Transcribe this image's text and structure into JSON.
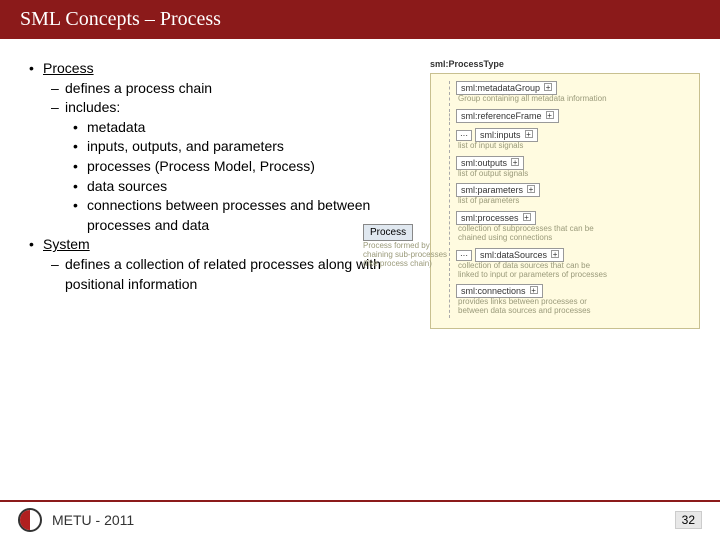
{
  "title": "SML Concepts – Process",
  "bullets": {
    "process": {
      "head": "Process",
      "sub1": "defines a process chain",
      "sub2": "includes:",
      "inc1": "metadata",
      "inc2": "inputs, outputs, and parameters",
      "inc3": "processes (Process Model, Process)",
      "inc4": "data sources",
      "inc5": "connections between processes and between processes and data"
    },
    "system": {
      "head": "System",
      "sub1": "defines a collection of related processes along with positional information"
    }
  },
  "diagram": {
    "root": "sml:ProcessType",
    "chip": "Process",
    "chip_note": "Process formed by chaining sub-processes (like process chain)",
    "items": [
      {
        "tag": "sml:metadataGroup",
        "desc": "Group containing all metadata information",
        "dots": false
      },
      {
        "tag": "sml:referenceFrame",
        "desc": "",
        "dots": false
      },
      {
        "tag": "sml:inputs",
        "desc": "list of input signals",
        "dots": true
      },
      {
        "tag": "sml:outputs",
        "desc": "list of output signals",
        "dots": false
      },
      {
        "tag": "sml:parameters",
        "desc": "list of parameters",
        "dots": false
      },
      {
        "tag": "sml:processes",
        "desc": "collection of subprocesses that can be chained using connections",
        "dots": false
      },
      {
        "tag": "sml:dataSources",
        "desc": "collection of data sources that can be linked to input or parameters of processes",
        "dots": true
      },
      {
        "tag": "sml:connections",
        "desc": "provides links between processes or between data sources and processes",
        "dots": false
      }
    ]
  },
  "footer": {
    "text": "METU - 2011",
    "page": "32"
  }
}
